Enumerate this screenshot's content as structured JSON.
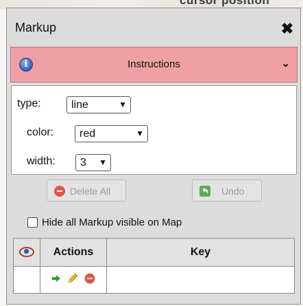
{
  "map_background": {
    "partial_text": "cursor position"
  },
  "panel": {
    "title": "Markup",
    "close_glyph": "✖",
    "instructions": {
      "label": "Instructions",
      "info_glyph": "i",
      "chevron_glyph": "⌄",
      "color": "#f0a0a4"
    },
    "type": {
      "label": "type:",
      "value": "line"
    },
    "color": {
      "label": "color:",
      "value": "red"
    },
    "width": {
      "label": "width:",
      "value": "3"
    },
    "dropdown_glyph": "▼",
    "delete_all": {
      "label": "Delete All",
      "icon": "minus-circle-icon",
      "disabled": true
    },
    "undo": {
      "label": "Undo",
      "icon": "undo-arrow-icon",
      "disabled": true
    },
    "hide_markup": {
      "label": "Hide all Markup visible on Map",
      "checked": false
    },
    "table": {
      "headers": {
        "visibility_icon": "eye-icon",
        "actions": "Actions",
        "key": "Key"
      },
      "rows": [
        {
          "actions": [
            "go-to-arrow-icon",
            "pencil-edit-icon",
            "delete-circle-icon"
          ],
          "key": ""
        }
      ]
    }
  }
}
